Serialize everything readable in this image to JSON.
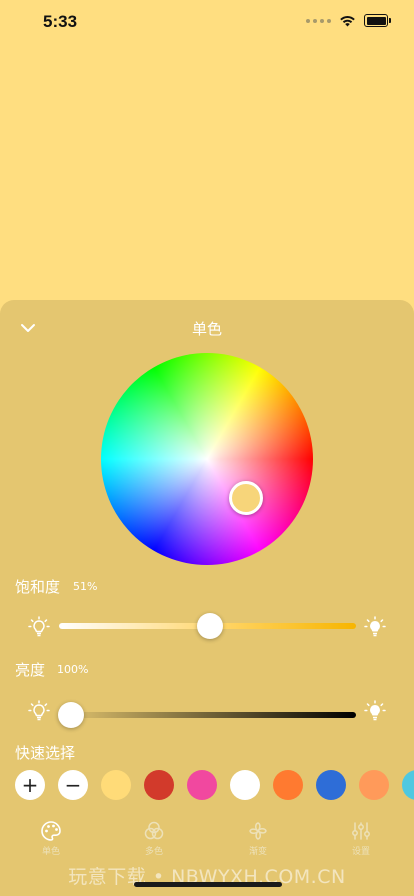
{
  "status": {
    "time": "5:33"
  },
  "panel": {
    "title": "单色",
    "selected_color": "#F7D57A"
  },
  "saturation": {
    "label": "饱和度",
    "value": "51%",
    "level": 0.51
  },
  "brightness": {
    "label": "亮度",
    "value": "100%",
    "level": 1.0
  },
  "quick_select": {
    "label": "快速选择",
    "add_label": "+",
    "remove_label": "−",
    "colors": [
      "#FFDB78",
      "#D23A2B",
      "#F1489F",
      "#FFFFFF",
      "#FF7A30",
      "#2E6DD7",
      "#FF9A5A",
      "#4FC8E0"
    ]
  },
  "tabs": [
    {
      "label": "单色",
      "icon": "palette-icon",
      "active": true
    },
    {
      "label": "多色",
      "icon": "three-circles-icon",
      "active": false
    },
    {
      "label": "渐变",
      "icon": "pinwheel-icon",
      "active": false
    },
    {
      "label": "设置",
      "icon": "sliders-icon",
      "active": false
    }
  ],
  "watermark": "玩意下载 • NBWYXH.COM.CN"
}
